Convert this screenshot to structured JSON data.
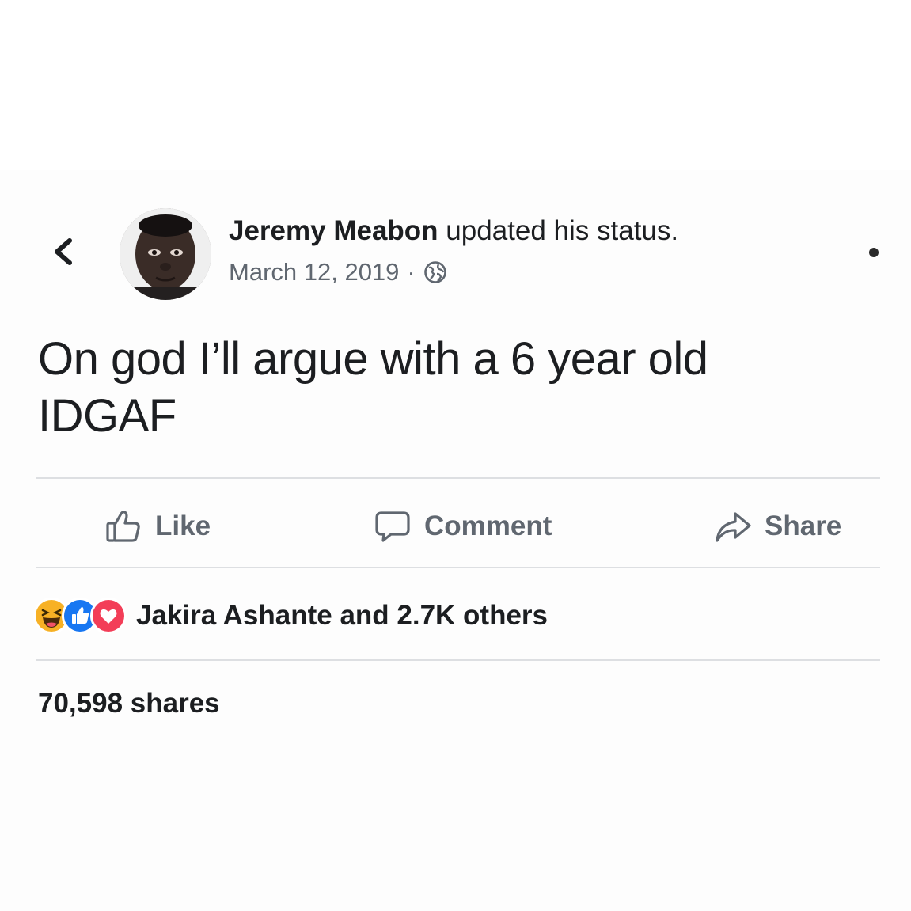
{
  "post": {
    "author": "Jeremy Meabon",
    "action": "updated his status.",
    "date": "March 12, 2019",
    "separator": "·",
    "audience_icon": "globe-icon",
    "status_lines": [
      "On god I’ll argue with a 6 year old",
      "IDGAF"
    ]
  },
  "nav": {
    "back_icon": "chevron-left-icon",
    "more_icon": "more-options-icon"
  },
  "actions": {
    "like": {
      "label": "Like",
      "icon": "thumbs-up-icon"
    },
    "comment": {
      "label": "Comment",
      "icon": "comment-icon"
    },
    "share": {
      "label": "Share",
      "icon": "share-arrow-icon"
    }
  },
  "engagement": {
    "reactions": [
      "haha-reaction-icon",
      "like-reaction-icon",
      "love-reaction-icon"
    ],
    "reaction_summary": "Jakira Ashante and 2.7K others",
    "shares": "70,598 shares"
  },
  "colors": {
    "text": "#1c1e21",
    "meta": "#606770",
    "divider": "#dddfe2",
    "like_blue": "#1877f2",
    "love_red": "#f33e58",
    "haha_yellow": "#f7b125"
  }
}
